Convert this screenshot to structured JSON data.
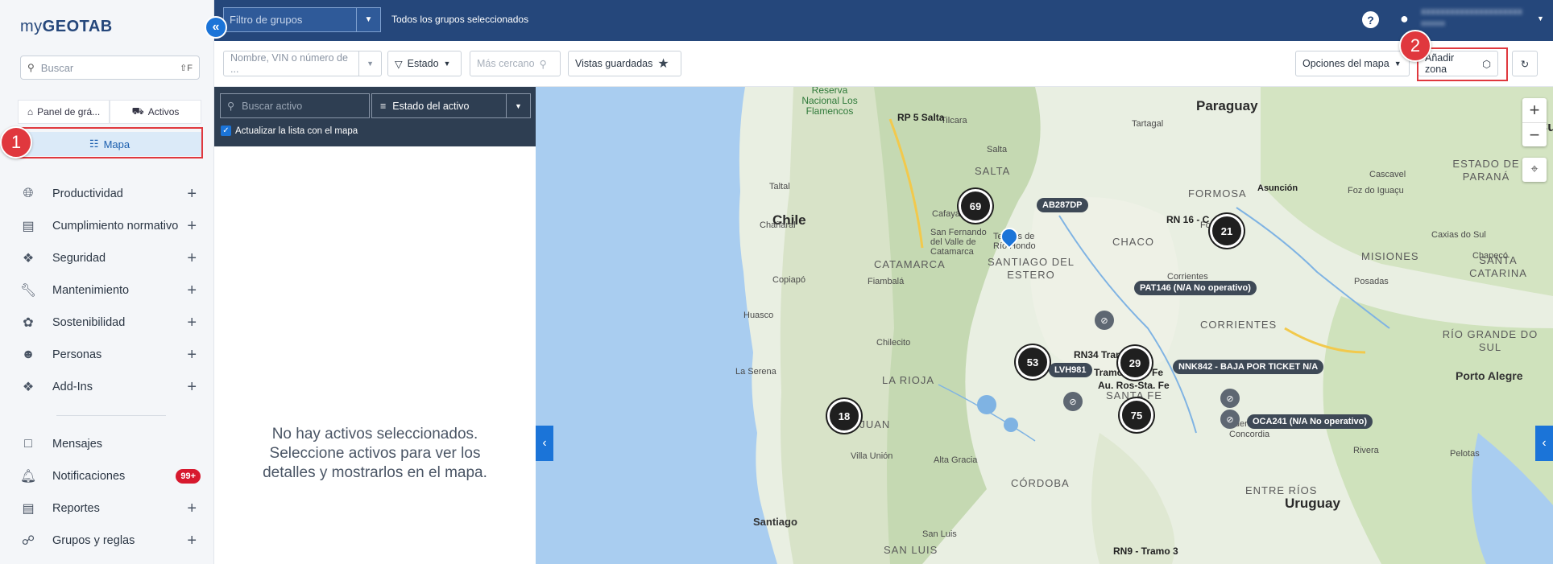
{
  "sidebar": {
    "logo_my": "my",
    "logo_geotab": "GEOTAB",
    "search_placeholder": "Buscar",
    "search_shortcut": "⇧F",
    "tab_dashboard": "Panel de grá...",
    "tab_assets": "Activos",
    "map_button": "Mapa",
    "items": [
      {
        "label": "Productividad",
        "icon": "globe-icon"
      },
      {
        "label": "Cumplimiento normativo",
        "icon": "clipboard-icon"
      },
      {
        "label": "Seguridad",
        "icon": "shield-icon"
      },
      {
        "label": "Mantenimiento",
        "icon": "wrench-icon"
      },
      {
        "label": "Sostenibilidad",
        "icon": "leaf-icon"
      },
      {
        "label": "Personas",
        "icon": "people-icon"
      },
      {
        "label": "Add-Ins",
        "icon": "puzzle-icon"
      }
    ],
    "items2": [
      {
        "label": "Mensajes",
        "icon": "messages-icon"
      },
      {
        "label": "Notificaciones",
        "icon": "bell-icon",
        "badge": "99+"
      },
      {
        "label": "Reportes",
        "icon": "report-icon"
      },
      {
        "label": "Grupos y reglas",
        "icon": "groups-icon"
      }
    ],
    "step1": "1",
    "step2": "2"
  },
  "topbar": {
    "group_filter_placeholder": "Filtro de grupos",
    "groups_selected": "Todos los grupos seleccionados",
    "help": "?"
  },
  "toolbar": {
    "vin_placeholder": "Nombre, VIN o número de ...",
    "state": "Estado",
    "nearest": "Más cercano",
    "saved_views": "Vistas guardadas",
    "map_options": "Opciones del mapa",
    "add_zone": "Añadir zona"
  },
  "asset_panel": {
    "search_placeholder": "Buscar activo",
    "state_label": "Estado del activo",
    "update_list": "Actualizar la lista con el mapa",
    "empty_line1": "No hay activos seleccionados.",
    "empty_line2": "Seleccione activos para ver los",
    "empty_line3": "detalles y mostrarlos en el mapa."
  },
  "map": {
    "countries": [
      "Paraguay",
      "Chile",
      "Uruguay"
    ],
    "provinces": [
      "SALTA",
      "CATAMARCA",
      "SANTIAGO DEL ESTERO",
      "CHACO",
      "FORMOSA",
      "MISIONES",
      "CORRIENTES",
      "LA RIOJA",
      "SAN JUAN",
      "SANTA FE",
      "CÓRDOBA",
      "ENTRE RÍOS",
      "SAN LUIS",
      "RÍO GRANDE DO SUL",
      "ESTADO DE PARANÁ",
      "SANTA CATARINA"
    ],
    "cities": [
      "Tilcara",
      "Salta",
      "Tartagal",
      "Asunción",
      "Cafayate",
      "Chañaral",
      "Taltal",
      "Copiapó",
      "Fiambalá",
      "Corrientes",
      "Posadas",
      "Chapecó",
      "Huasco",
      "Chilecito",
      "La Serena",
      "Santiago",
      "Porto Alegre",
      "Concordia",
      "Federación",
      "Pelotas",
      "Cascavel",
      "Foz do Iguaçu",
      "Formosa",
      "San Fernando del Valle de Catamarca",
      "Termas de Río Hondo",
      "Villa Unión",
      "Alta Gracia",
      "San Luis",
      "Rivera",
      "Caxias do Sul"
    ],
    "clusters": [
      "69",
      "21",
      "53",
      "29",
      "75",
      "18"
    ],
    "tags": [
      "AB287DP",
      "PAT146 (N/A No operativo)",
      "LVH981",
      "NNK842 - BAJA POR TICKET N/A",
      "OCA241 (N/A No operativo)"
    ],
    "roads": [
      "RP 5 Salta",
      "RN 16 - C",
      "RN34 Tramo 01",
      "Tramo Rafa. Fe",
      "Au. Ros-Sta. Fe",
      "RN9 - Tramo 3"
    ],
    "park": "Reserva Nacional Los Flamencos",
    "cu": "Cu",
    "zoom_in": "+",
    "zoom_out": "−"
  }
}
